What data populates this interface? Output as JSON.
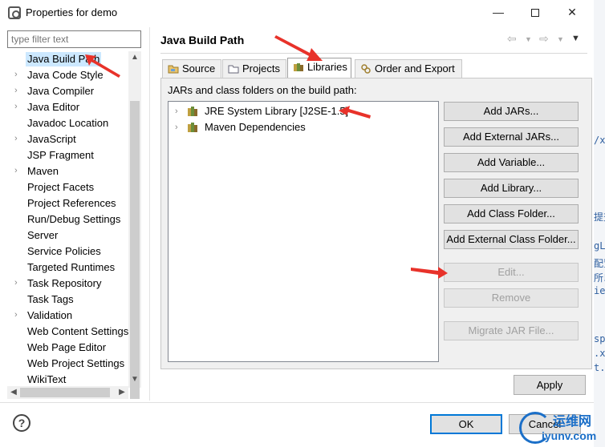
{
  "window": {
    "title": "Properties for demo",
    "minimize": "—",
    "close": "✕"
  },
  "filter": {
    "placeholder": "type filter text"
  },
  "left_tree": {
    "items": [
      {
        "label": "Java Build Path",
        "expandable": false,
        "selected": true
      },
      {
        "label": "Java Code Style",
        "expandable": true
      },
      {
        "label": "Java Compiler",
        "expandable": true
      },
      {
        "label": "Java Editor",
        "expandable": true
      },
      {
        "label": "Javadoc Location",
        "expandable": false
      },
      {
        "label": "JavaScript",
        "expandable": true
      },
      {
        "label": "JSP Fragment",
        "expandable": false
      },
      {
        "label": "Maven",
        "expandable": true
      },
      {
        "label": "Project Facets",
        "expandable": false
      },
      {
        "label": "Project References",
        "expandable": false
      },
      {
        "label": "Run/Debug Settings",
        "expandable": false
      },
      {
        "label": "Server",
        "expandable": false
      },
      {
        "label": "Service Policies",
        "expandable": false
      },
      {
        "label": "Targeted Runtimes",
        "expandable": false
      },
      {
        "label": "Task Repository",
        "expandable": true
      },
      {
        "label": "Task Tags",
        "expandable": false
      },
      {
        "label": "Validation",
        "expandable": true
      },
      {
        "label": "Web Content Settings",
        "expandable": false
      },
      {
        "label": "Web Page Editor",
        "expandable": false
      },
      {
        "label": "Web Project Settings",
        "expandable": false
      },
      {
        "label": "WikiText",
        "expandable": false
      }
    ]
  },
  "page": {
    "title": "Java Build Path",
    "tabs": [
      {
        "label": "Source",
        "icon": "source-folder-icon"
      },
      {
        "label": "Projects",
        "icon": "projects-folder-icon"
      },
      {
        "label": "Libraries",
        "icon": "libraries-icon",
        "active": true
      },
      {
        "label": "Order and Export",
        "icon": "order-export-icon"
      }
    ],
    "panel_label": "JARs and class folders on the build path:",
    "libraries": [
      {
        "label": "JRE System Library [J2SE-1.5]"
      },
      {
        "label": "Maven Dependencies"
      }
    ],
    "buttons": {
      "add_jars": "Add JARs...",
      "add_external_jars": "Add External JARs...",
      "add_variable": "Add Variable...",
      "add_library": "Add Library...",
      "add_class_folder": "Add Class Folder...",
      "add_external_class_folder": "Add External Class Folder...",
      "edit": "Edit...",
      "remove": "Remove",
      "migrate_jar": "Migrate JAR File..."
    },
    "apply": "Apply"
  },
  "footer": {
    "help": "?",
    "ok": "OK",
    "cancel": "Cancel"
  },
  "watermark": {
    "cn": "运维网",
    "url": "iyunv.com"
  },
  "colors": {
    "annotation_arrow": "#e8322a",
    "selection": "#cce8ff",
    "watermark": "#1b6fc8"
  }
}
